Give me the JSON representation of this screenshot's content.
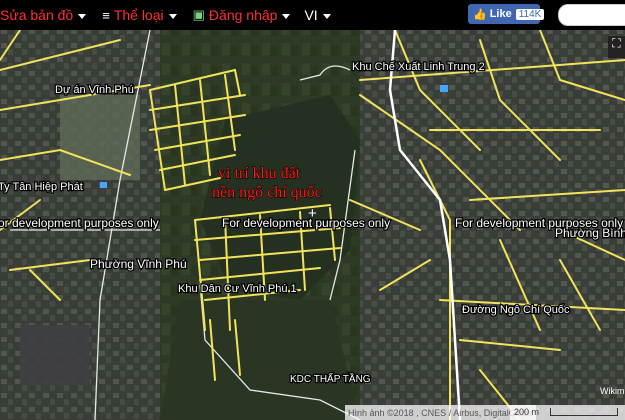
{
  "menu": {
    "edit_label": "Sửa bản đồ",
    "category_label": "Thể loại",
    "login_label": "Đăng nhập",
    "language_label": "VI"
  },
  "facebook": {
    "like_label": "Like",
    "like_count": "114K"
  },
  "map_labels": {
    "khu_che_xuat": "Khu Chế Xuất Linh Trung 2",
    "du_an_vinh_phu": "Dự án Vĩnh Phú",
    "tan_hiep_phat": "Ty Tân Hiệp Phát",
    "phuong_vinh_phu": "Phường Vĩnh Phú",
    "khu_dan_cu": "Khu Dân Cư Vĩnh Phú 1",
    "duong_ngo_chi_quoc": "Đường Ngô Chí Quốc",
    "phuong_binh": "Phường Bình",
    "kdc_thap_tang": "KDC THẤP TẦNG",
    "dev_left": "or development purposes only",
    "dev_center": "For development purposes only",
    "dev_right": "For development purposes only"
  },
  "annotation": {
    "line1": "vị trí khu đất",
    "line2": "nền ngô chí quốc",
    "marker": "+"
  },
  "attribution": "Hình ảnh ©2018 , CNES / Airbus, DigitalGlobe",
  "scale_label": "200 m",
  "wikimapia_label": "Wikim",
  "colors": {
    "road": "#f2e35a",
    "menu_text": "#ff2f2f",
    "annotation": "#ff1a1a",
    "facebook": "#4267b2"
  }
}
